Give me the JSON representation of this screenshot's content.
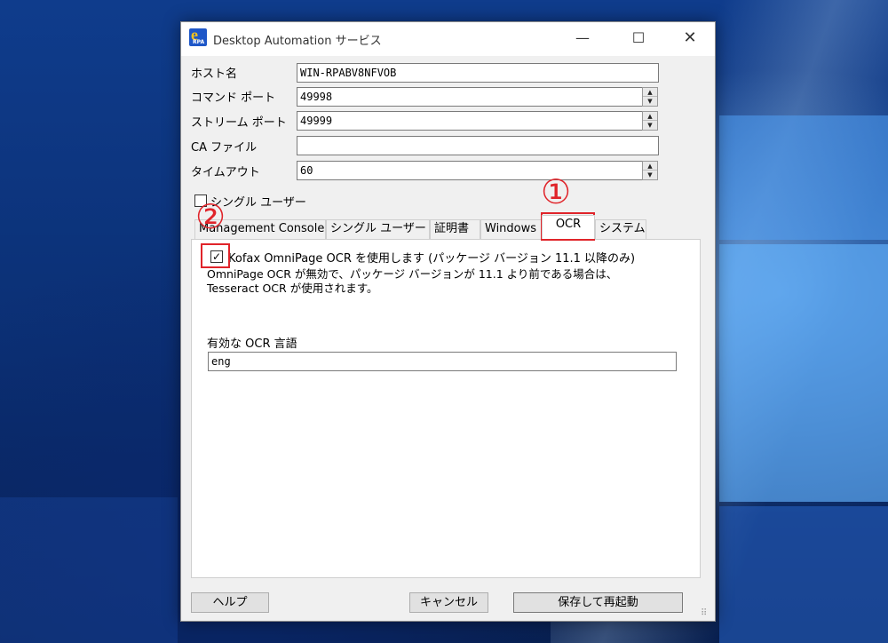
{
  "window": {
    "title": "Desktop Automation サービス",
    "minimize_glyph": "—",
    "maximize_glyph": "☐",
    "close_glyph": "✕"
  },
  "form": {
    "host_label": "ホスト名",
    "host_value": "WIN-RPABV8NFVOB",
    "command_port_label": "コマンド ポート",
    "command_port_value": "49998",
    "stream_port_label": "ストリーム ポート",
    "stream_port_value": "49999",
    "ca_file_label": "CA ファイル",
    "ca_file_value": "",
    "timeout_label": "タイムアウト",
    "timeout_value": "60",
    "single_user_label": "シングル ユーザー",
    "single_user_checked": false
  },
  "tabs": [
    {
      "label": "Management Console"
    },
    {
      "label": "シングル ユーザー"
    },
    {
      "label": "証明書"
    },
    {
      "label": "Windows"
    },
    {
      "label": "OCR"
    },
    {
      "label": "システム"
    }
  ],
  "active_tab": "OCR",
  "ocr": {
    "omnipage_checkbox_label": "Kofax OmniPage OCR を使用します (パッケージ バージョン 11.1 以降のみ)",
    "omnipage_checked": true,
    "note_line1": "OmniPage OCR が無効で、パッケージ バージョンが 11.1 より前である場合は、",
    "note_line2": "Tesseract OCR が使用されます。",
    "languages_label": "有効な OCR 言語",
    "languages_value": "eng"
  },
  "buttons": {
    "help": "ヘルプ",
    "cancel": "キャンセル",
    "save_restart": "保存して再起動"
  },
  "annotations": {
    "marker1": "①",
    "marker2": "②",
    "color": "#e0242a"
  },
  "icons": {
    "app": "kofax-rpa-icon",
    "check": "✓",
    "spin_up": "▲",
    "spin_down": "▼"
  }
}
